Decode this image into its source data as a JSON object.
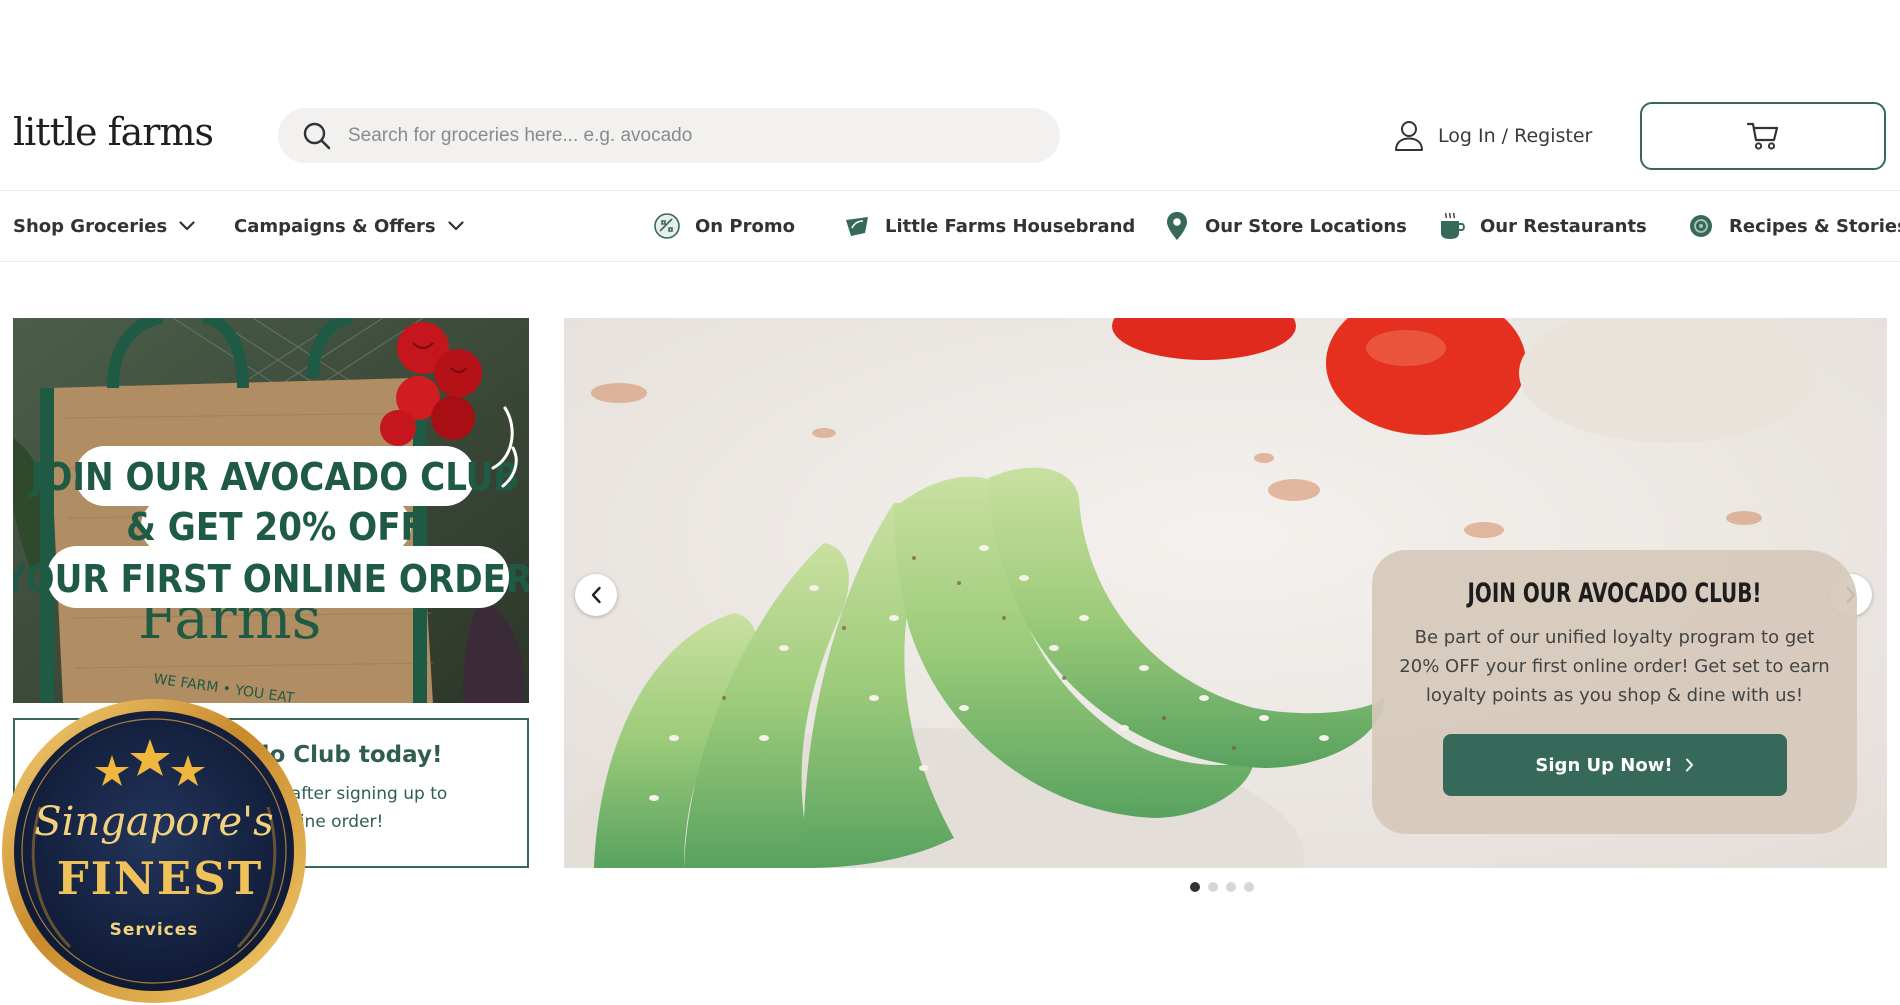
{
  "header": {
    "logo_text": "little farms",
    "search_placeholder": "Search for groceries here... e.g. avocado",
    "login_label": "Log In / Register"
  },
  "nav": {
    "shop_groceries": "Shop Groceries",
    "campaigns_offers": "Campaigns & Offers",
    "on_promo": "On Promo",
    "housebrand": "Little Farms Housebrand",
    "store_locations": "Our Store Locations",
    "restaurants": "Our Restaurants",
    "recipes_stories": "Recipes & Stories"
  },
  "promo": {
    "image_line1": "JOIN OUR AVOCADO CLUB",
    "image_line2": "& GET 20% OFF",
    "image_line3": "YOUR FIRST ONLINE ORDER!",
    "bag_brand": "Farms",
    "bag_tagline": "WE FARM • YOU EAT",
    "card_title": "do Club today!",
    "card_desc_line1": "E20 after signing up to",
    "card_desc_line2": "st online order!"
  },
  "hero": {
    "title": "JOIN OUR AVOCADO CLUB!",
    "description": "Be part of our unified loyalty program to get 20% OFF your first online order! Get set to earn loyalty points as you shop & dine with us!",
    "button_label": "Sign Up Now!",
    "slide_count": 4,
    "active_slide": 1
  },
  "badge": {
    "script_text": "Singapore's",
    "main_text": "FINEST",
    "sub_text": "Services"
  },
  "colors": {
    "brand_green": "#36695a",
    "badge_gold": "#d9a441",
    "badge_navy": "#14213d"
  }
}
